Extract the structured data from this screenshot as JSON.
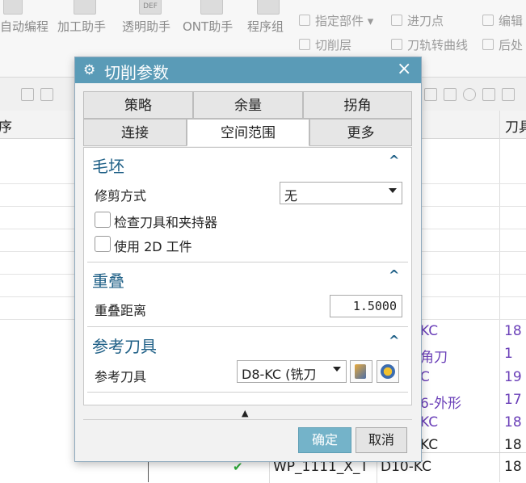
{
  "ribbon": {
    "buttons": [
      "自动编程",
      "加工助手",
      "透明助手",
      "ONT助手",
      "程序组"
    ],
    "def_icon": "DEF",
    "right_items": [
      {
        "label": "指定部件",
        "icon": "part-icon"
      },
      {
        "label": "进刀点",
        "icon": "entry-point-icon"
      },
      {
        "label": "编辑",
        "icon": "edit-icon"
      },
      {
        "label": "切削层",
        "icon": "cut-level-icon"
      },
      {
        "label": "刀轨转曲线",
        "icon": "path-to-curve-icon"
      },
      {
        "label": "后处",
        "icon": "post-icon"
      }
    ]
  },
  "background_table": {
    "left_header": "序",
    "right_header": "刀具",
    "rows": [
      {
        "text": "KC",
        "num": "18"
      },
      {
        "text": "角刀",
        "num": "1"
      },
      {
        "text": "C",
        "num": "19"
      },
      {
        "text": "6-外形",
        "num": "17"
      },
      {
        "text": "KC",
        "num": "18"
      },
      {
        "text": "KC",
        "num": "18"
      }
    ],
    "last_row": {
      "check": "✔",
      "name": "WP_1111_X_T",
      "tool": "D10-KC",
      "num": "18"
    }
  },
  "dialog": {
    "title": "切削参数",
    "close": "×",
    "tabs_row1": [
      "策略",
      "余量",
      "拐角"
    ],
    "tabs_row2": [
      "连接",
      "空间范围",
      "更多"
    ],
    "active_tab": "空间范围",
    "sections": {
      "blank": {
        "title": "毛坯",
        "trim_label": "修剪方式",
        "trim_value": "无",
        "check_tool_holder": "检查刀具和夹持器",
        "use_2d": "使用 2D 工件"
      },
      "overlap": {
        "title": "重叠",
        "distance_label": "重叠距离",
        "distance_value": "1.5000"
      },
      "ref_tool": {
        "title": "参考刀具",
        "label": "参考刀具",
        "value": "D8-KC (铣刀"
      }
    },
    "caret": "^",
    "more_arrow": "▲",
    "ok": "确定",
    "cancel": "取消"
  }
}
